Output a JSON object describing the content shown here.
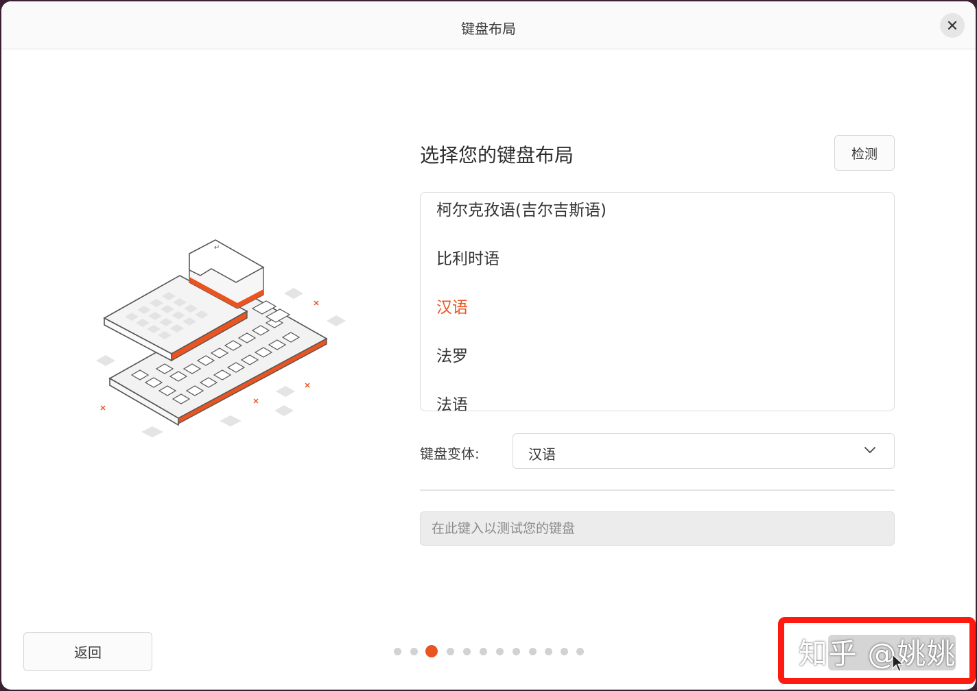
{
  "window": {
    "title": "键盘布局"
  },
  "heading": "选择您的键盘布局",
  "detect_button": "检测",
  "layout_list": {
    "items": [
      "柯尔克孜语(吉尔吉斯语)",
      "比利时语",
      "汉语",
      "法罗",
      "法语"
    ],
    "selected": "汉语"
  },
  "variant": {
    "label": "键盘变体:",
    "value": "汉语"
  },
  "test_input": {
    "placeholder": "在此键入以测试您的键盘"
  },
  "back_button": "返回",
  "progress": {
    "total_steps": 12,
    "current_step": 3
  },
  "watermark": "知乎 @姚姚",
  "colors": {
    "accent": "#e95420",
    "annotation_frame": "#ff1a10"
  },
  "icons": {
    "close": "close-icon",
    "dropdown": "chevron-down-icon",
    "illustration": "keyboard-illustration"
  }
}
